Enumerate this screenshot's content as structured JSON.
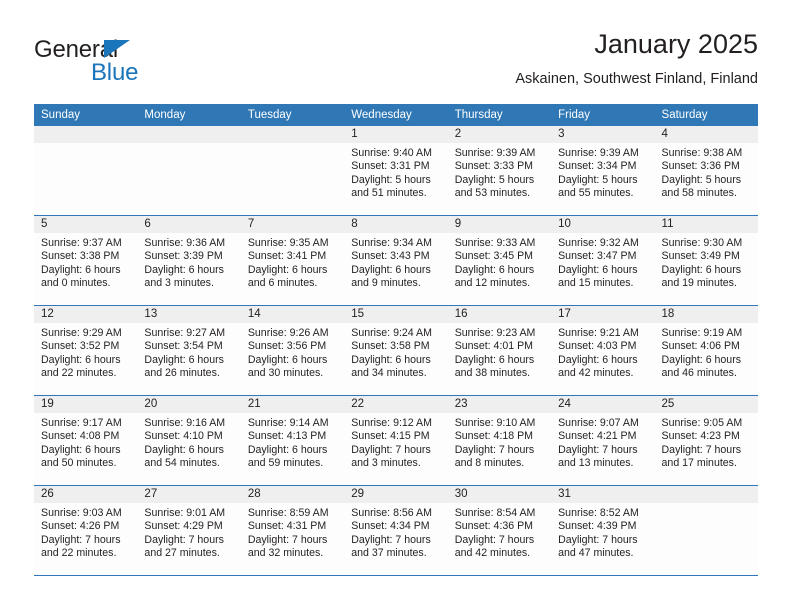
{
  "logo": {
    "word1": "General",
    "word2": "Blue",
    "triangle_color": "#1b75bb"
  },
  "header": {
    "title": "January 2025",
    "subtitle": "Askainen, Southwest Finland, Finland"
  },
  "colors": {
    "header_blue": "#2f77b5",
    "daynum_band": "#efefef",
    "text": "#231f20"
  },
  "weekday_headers": [
    "Sunday",
    "Monday",
    "Tuesday",
    "Wednesday",
    "Thursday",
    "Friday",
    "Saturday"
  ],
  "weeks": [
    [
      {
        "day": "",
        "sunrise": "",
        "sunset": "",
        "daylight1": "",
        "daylight2": ""
      },
      {
        "day": "",
        "sunrise": "",
        "sunset": "",
        "daylight1": "",
        "daylight2": ""
      },
      {
        "day": "",
        "sunrise": "",
        "sunset": "",
        "daylight1": "",
        "daylight2": ""
      },
      {
        "day": "1",
        "sunrise": "Sunrise: 9:40 AM",
        "sunset": "Sunset: 3:31 PM",
        "daylight1": "Daylight: 5 hours",
        "daylight2": "and 51 minutes."
      },
      {
        "day": "2",
        "sunrise": "Sunrise: 9:39 AM",
        "sunset": "Sunset: 3:33 PM",
        "daylight1": "Daylight: 5 hours",
        "daylight2": "and 53 minutes."
      },
      {
        "day": "3",
        "sunrise": "Sunrise: 9:39 AM",
        "sunset": "Sunset: 3:34 PM",
        "daylight1": "Daylight: 5 hours",
        "daylight2": "and 55 minutes."
      },
      {
        "day": "4",
        "sunrise": "Sunrise: 9:38 AM",
        "sunset": "Sunset: 3:36 PM",
        "daylight1": "Daylight: 5 hours",
        "daylight2": "and 58 minutes."
      }
    ],
    [
      {
        "day": "5",
        "sunrise": "Sunrise: 9:37 AM",
        "sunset": "Sunset: 3:38 PM",
        "daylight1": "Daylight: 6 hours",
        "daylight2": "and 0 minutes."
      },
      {
        "day": "6",
        "sunrise": "Sunrise: 9:36 AM",
        "sunset": "Sunset: 3:39 PM",
        "daylight1": "Daylight: 6 hours",
        "daylight2": "and 3 minutes."
      },
      {
        "day": "7",
        "sunrise": "Sunrise: 9:35 AM",
        "sunset": "Sunset: 3:41 PM",
        "daylight1": "Daylight: 6 hours",
        "daylight2": "and 6 minutes."
      },
      {
        "day": "8",
        "sunrise": "Sunrise: 9:34 AM",
        "sunset": "Sunset: 3:43 PM",
        "daylight1": "Daylight: 6 hours",
        "daylight2": "and 9 minutes."
      },
      {
        "day": "9",
        "sunrise": "Sunrise: 9:33 AM",
        "sunset": "Sunset: 3:45 PM",
        "daylight1": "Daylight: 6 hours",
        "daylight2": "and 12 minutes."
      },
      {
        "day": "10",
        "sunrise": "Sunrise: 9:32 AM",
        "sunset": "Sunset: 3:47 PM",
        "daylight1": "Daylight: 6 hours",
        "daylight2": "and 15 minutes."
      },
      {
        "day": "11",
        "sunrise": "Sunrise: 9:30 AM",
        "sunset": "Sunset: 3:49 PM",
        "daylight1": "Daylight: 6 hours",
        "daylight2": "and 19 minutes."
      }
    ],
    [
      {
        "day": "12",
        "sunrise": "Sunrise: 9:29 AM",
        "sunset": "Sunset: 3:52 PM",
        "daylight1": "Daylight: 6 hours",
        "daylight2": "and 22 minutes."
      },
      {
        "day": "13",
        "sunrise": "Sunrise: 9:27 AM",
        "sunset": "Sunset: 3:54 PM",
        "daylight1": "Daylight: 6 hours",
        "daylight2": "and 26 minutes."
      },
      {
        "day": "14",
        "sunrise": "Sunrise: 9:26 AM",
        "sunset": "Sunset: 3:56 PM",
        "daylight1": "Daylight: 6 hours",
        "daylight2": "and 30 minutes."
      },
      {
        "day": "15",
        "sunrise": "Sunrise: 9:24 AM",
        "sunset": "Sunset: 3:58 PM",
        "daylight1": "Daylight: 6 hours",
        "daylight2": "and 34 minutes."
      },
      {
        "day": "16",
        "sunrise": "Sunrise: 9:23 AM",
        "sunset": "Sunset: 4:01 PM",
        "daylight1": "Daylight: 6 hours",
        "daylight2": "and 38 minutes."
      },
      {
        "day": "17",
        "sunrise": "Sunrise: 9:21 AM",
        "sunset": "Sunset: 4:03 PM",
        "daylight1": "Daylight: 6 hours",
        "daylight2": "and 42 minutes."
      },
      {
        "day": "18",
        "sunrise": "Sunrise: 9:19 AM",
        "sunset": "Sunset: 4:06 PM",
        "daylight1": "Daylight: 6 hours",
        "daylight2": "and 46 minutes."
      }
    ],
    [
      {
        "day": "19",
        "sunrise": "Sunrise: 9:17 AM",
        "sunset": "Sunset: 4:08 PM",
        "daylight1": "Daylight: 6 hours",
        "daylight2": "and 50 minutes."
      },
      {
        "day": "20",
        "sunrise": "Sunrise: 9:16 AM",
        "sunset": "Sunset: 4:10 PM",
        "daylight1": "Daylight: 6 hours",
        "daylight2": "and 54 minutes."
      },
      {
        "day": "21",
        "sunrise": "Sunrise: 9:14 AM",
        "sunset": "Sunset: 4:13 PM",
        "daylight1": "Daylight: 6 hours",
        "daylight2": "and 59 minutes."
      },
      {
        "day": "22",
        "sunrise": "Sunrise: 9:12 AM",
        "sunset": "Sunset: 4:15 PM",
        "daylight1": "Daylight: 7 hours",
        "daylight2": "and 3 minutes."
      },
      {
        "day": "23",
        "sunrise": "Sunrise: 9:10 AM",
        "sunset": "Sunset: 4:18 PM",
        "daylight1": "Daylight: 7 hours",
        "daylight2": "and 8 minutes."
      },
      {
        "day": "24",
        "sunrise": "Sunrise: 9:07 AM",
        "sunset": "Sunset: 4:21 PM",
        "daylight1": "Daylight: 7 hours",
        "daylight2": "and 13 minutes."
      },
      {
        "day": "25",
        "sunrise": "Sunrise: 9:05 AM",
        "sunset": "Sunset: 4:23 PM",
        "daylight1": "Daylight: 7 hours",
        "daylight2": "and 17 minutes."
      }
    ],
    [
      {
        "day": "26",
        "sunrise": "Sunrise: 9:03 AM",
        "sunset": "Sunset: 4:26 PM",
        "daylight1": "Daylight: 7 hours",
        "daylight2": "and 22 minutes."
      },
      {
        "day": "27",
        "sunrise": "Sunrise: 9:01 AM",
        "sunset": "Sunset: 4:29 PM",
        "daylight1": "Daylight: 7 hours",
        "daylight2": "and 27 minutes."
      },
      {
        "day": "28",
        "sunrise": "Sunrise: 8:59 AM",
        "sunset": "Sunset: 4:31 PM",
        "daylight1": "Daylight: 7 hours",
        "daylight2": "and 32 minutes."
      },
      {
        "day": "29",
        "sunrise": "Sunrise: 8:56 AM",
        "sunset": "Sunset: 4:34 PM",
        "daylight1": "Daylight: 7 hours",
        "daylight2": "and 37 minutes."
      },
      {
        "day": "30",
        "sunrise": "Sunrise: 8:54 AM",
        "sunset": "Sunset: 4:36 PM",
        "daylight1": "Daylight: 7 hours",
        "daylight2": "and 42 minutes."
      },
      {
        "day": "31",
        "sunrise": "Sunrise: 8:52 AM",
        "sunset": "Sunset: 4:39 PM",
        "daylight1": "Daylight: 7 hours",
        "daylight2": "and 47 minutes."
      },
      {
        "day": "",
        "sunrise": "",
        "sunset": "",
        "daylight1": "",
        "daylight2": ""
      }
    ]
  ]
}
